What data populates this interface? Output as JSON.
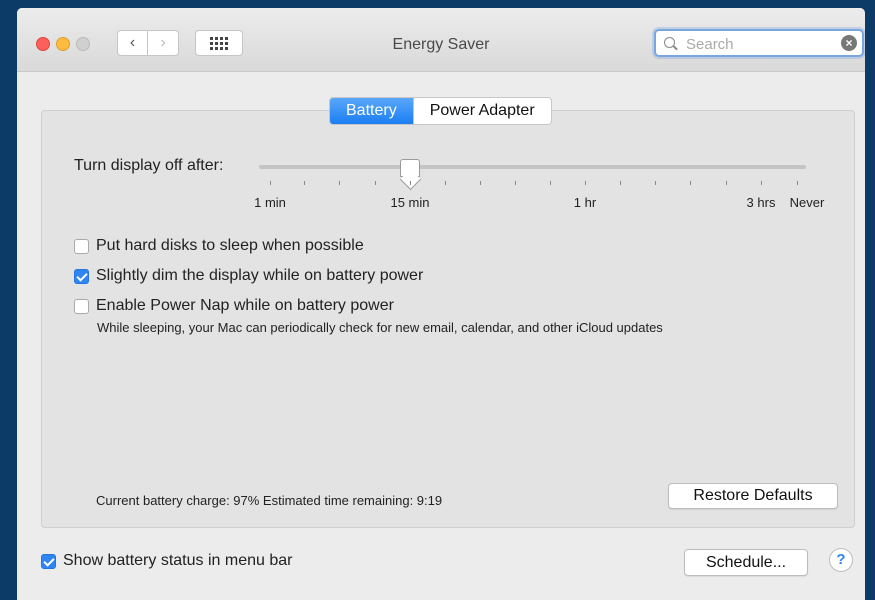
{
  "window": {
    "title": "Energy Saver"
  },
  "toolbar": {
    "back_label": "‹",
    "forward_label": "›",
    "search": {
      "placeholder": "Search",
      "value": ""
    },
    "clear_label": "×"
  },
  "tabs": [
    {
      "label": "Battery",
      "selected": true
    },
    {
      "label": "Power Adapter",
      "selected": false
    }
  ],
  "display_sleep": {
    "label": "Turn display off after:",
    "value": "15 min",
    "tick_labels": [
      "1 min",
      "15 min",
      "1 hr",
      "3 hrs",
      "Never"
    ]
  },
  "options": [
    {
      "label": "Put hard disks to sleep when possible",
      "checked": false
    },
    {
      "label": "Slightly dim the display while on battery power",
      "checked": true
    },
    {
      "label": "Enable Power Nap while on battery power",
      "checked": false
    }
  ],
  "power_nap_description": "While sleeping, your Mac can periodically check for new email, calendar, and other iCloud updates",
  "battery_status_text": "Current battery charge: 97%  Estimated time remaining: 9:19",
  "buttons": {
    "restore_defaults": "Restore Defaults",
    "schedule": "Schedule...",
    "help": "?"
  },
  "menu_bar_option": {
    "label": "Show battery status in menu bar",
    "checked": true
  },
  "colors": {
    "accent": "#2f86f3",
    "desktop": "#0b3b66"
  }
}
